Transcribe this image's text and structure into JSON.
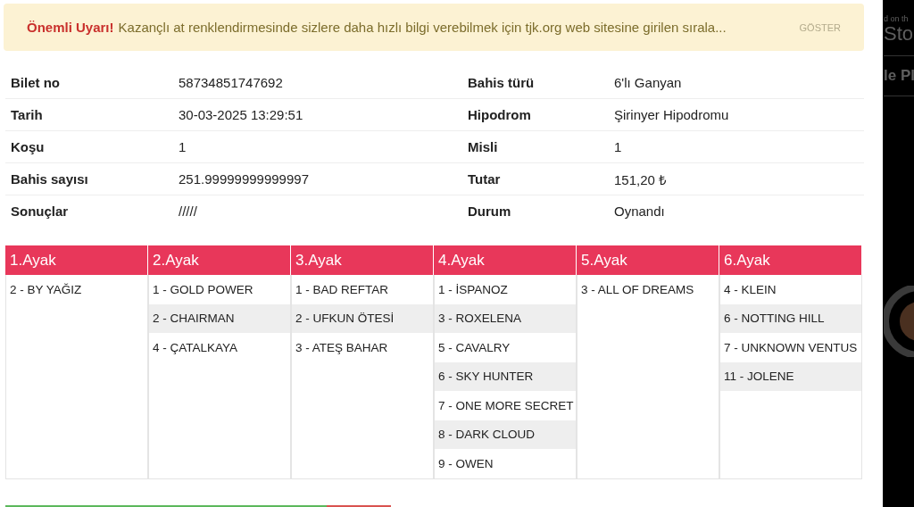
{
  "alert": {
    "title": "Önemli Uyarı!",
    "message": "Kazançlı at renklendirmesinde sizlere daha hızlı bilgi verebilmek için tjk.org web sitesine girilen sırala...",
    "action": "GÖSTER"
  },
  "details": [
    {
      "label": "Bilet no",
      "value": "58734851747692",
      "label_2": "Bahis türü",
      "value_2": "6'lı Ganyan"
    },
    {
      "label": "Tarih",
      "value": "30-03-2025 13:29:51",
      "label_2": "Hipodrom",
      "value_2": "Şirinyer Hipodromu"
    },
    {
      "label": "Koşu",
      "value": "1",
      "label_2": "Misli",
      "value_2": "1"
    },
    {
      "label": "Bahis sayısı",
      "value": "251.99999999999997",
      "label_2": "Tutar",
      "value_2": "151,20 ₺"
    },
    {
      "label": "Sonuçlar",
      "value": "/////",
      "label_2": "Durum",
      "value_2": "Oynandı"
    }
  ],
  "legs": [
    {
      "title": "1.Ayak",
      "horses": [
        "2 - BY YAĞIZ"
      ]
    },
    {
      "title": "2.Ayak",
      "horses": [
        "1 - GOLD POWER",
        "2 - CHAIRMAN",
        "4 - ÇATALKAYA"
      ]
    },
    {
      "title": "3.Ayak",
      "horses": [
        "1 - BAD REFTAR",
        "2 - UFKUN ÖTESİ",
        "3 - ATEŞ BAHAR"
      ]
    },
    {
      "title": "4.Ayak",
      "horses": [
        "1 - İSPANOZ",
        "3 - ROXELENA",
        "5 - CAVALRY",
        "6 - SKY HUNTER",
        "7 - ONE MORE SECRET",
        "8 - DARK CLOUD",
        "9 - OWEN"
      ]
    },
    {
      "title": "5.Ayak",
      "horses": [
        "3 - ALL OF DREAMS"
      ]
    },
    {
      "title": "6.Ayak",
      "horses": [
        "4 - KLEIN",
        "6 - NOTTING HILL",
        "7 - UNKNOWN VENTUS",
        "11 - JOLENE"
      ]
    }
  ],
  "side_panel": {
    "texts": [
      "d on th",
      "Sto",
      "le Pl"
    ]
  }
}
